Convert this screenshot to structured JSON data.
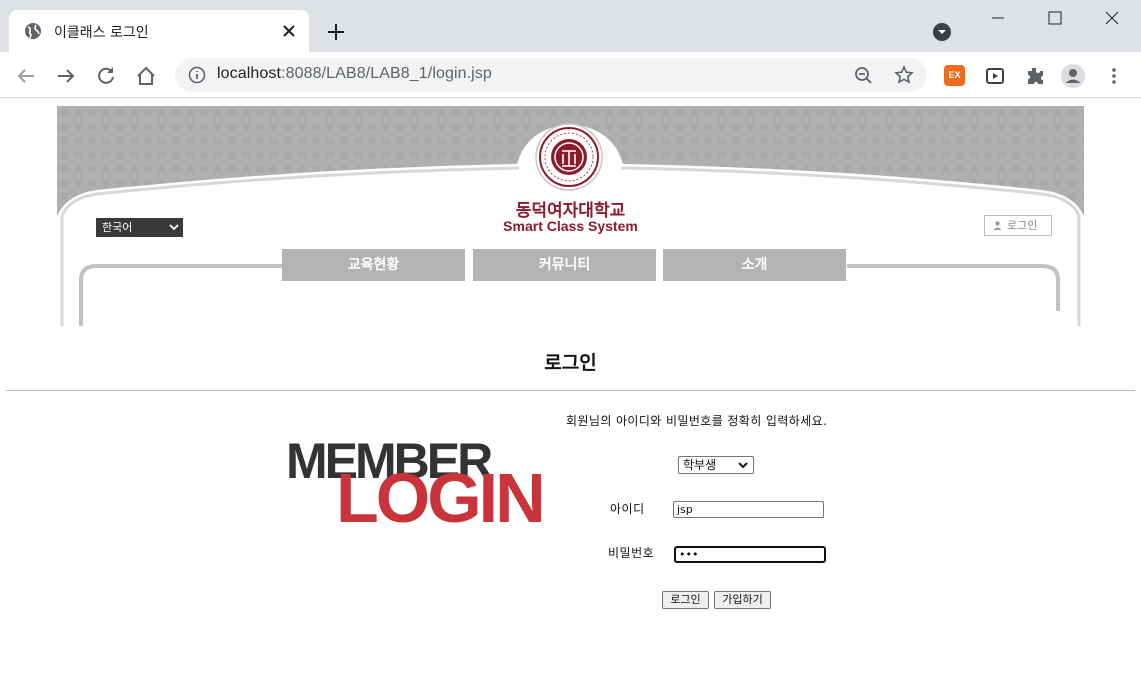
{
  "browser": {
    "tab_title": "이클래스 로그인",
    "url_host": "localhost",
    "url_path": ":8088/LAB8/LAB8_1/login.jsp",
    "icons": [
      "globe-icon",
      "close-icon",
      "plus-icon",
      "back-icon",
      "forward-icon",
      "reload-icon",
      "home-icon",
      "info-icon",
      "zoom-out-icon",
      "star-icon",
      "extensions-icon",
      "profile-icon",
      "menu-icon"
    ],
    "ext_label": "EX"
  },
  "header": {
    "university_name": "동덕여자대학교",
    "system_name": "Smart Class System",
    "language": "한국어",
    "login_label": "로그인",
    "nav": [
      "교육현황",
      "커뮤니티",
      "소개"
    ]
  },
  "login": {
    "title": "로그인",
    "logo_line1": "MEMBER",
    "logo_line2": "LOGIN",
    "instruction": "회원님의 아이디와 비밀번호를 정확히 입력하세요.",
    "role": "학부생",
    "id_label": "아이디",
    "id_value": "jsp",
    "pw_label": "비밀번호",
    "pw_value": "•••",
    "submit_label": "로그인",
    "signup_label": "가입하기"
  },
  "colors": {
    "brand": "#8b1a2b",
    "logo_red": "#c9343a",
    "nav_gray": "#b3b3b3"
  }
}
